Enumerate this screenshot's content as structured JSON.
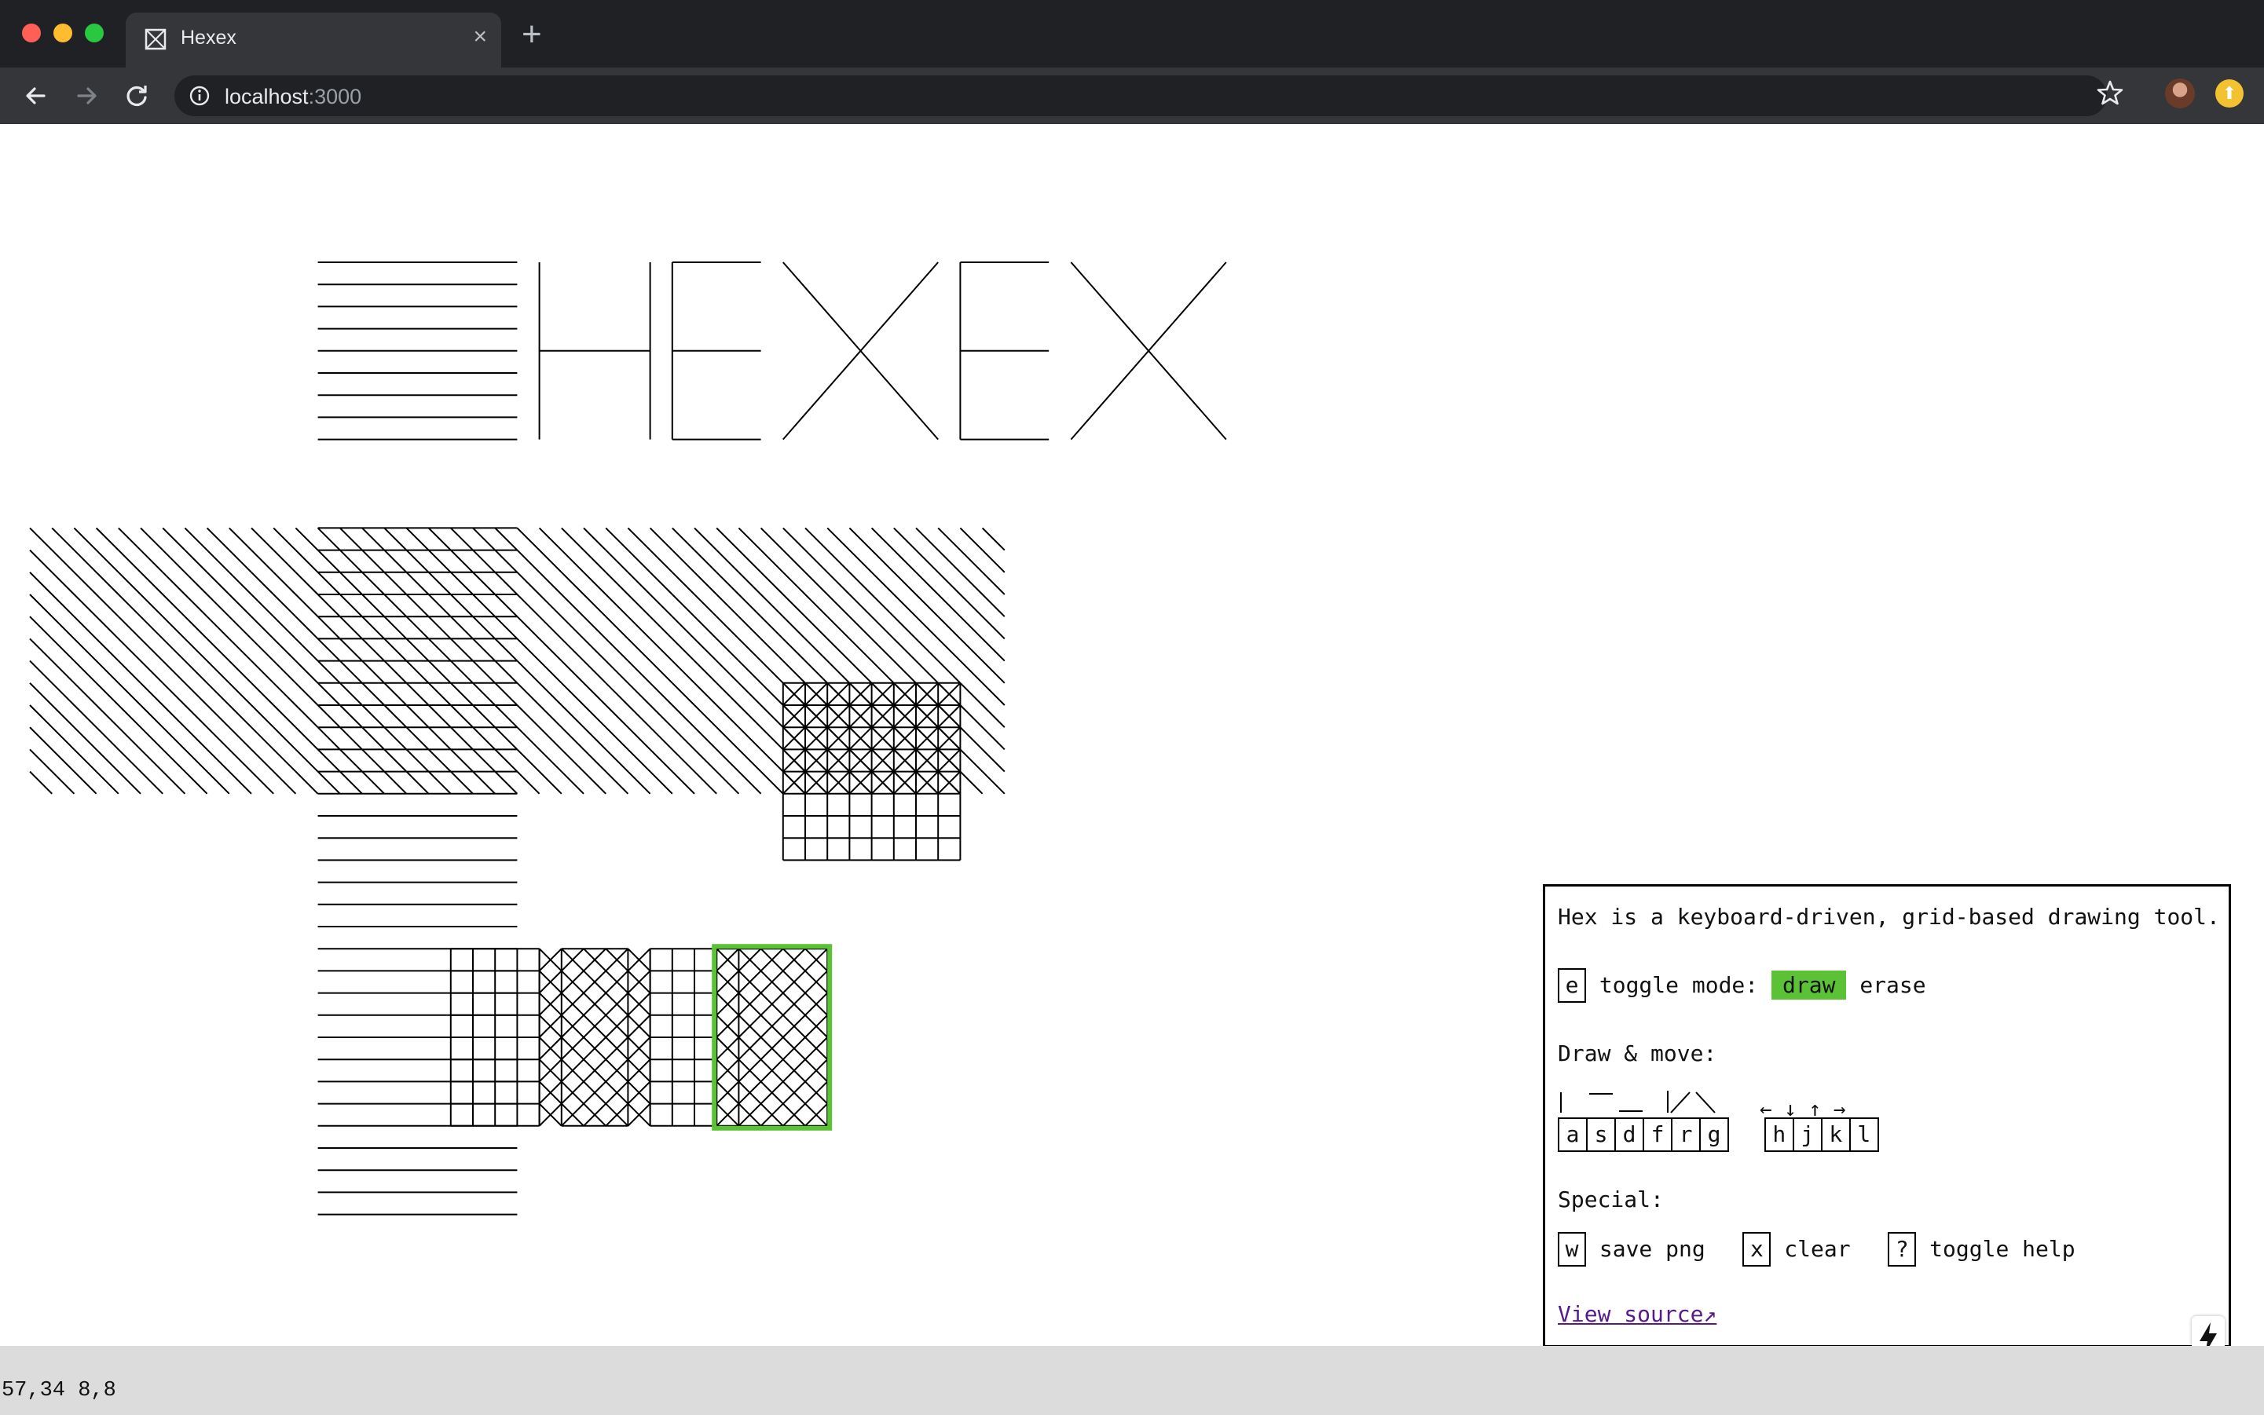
{
  "browser": {
    "tab_title": "Hexex",
    "tab_close": "×",
    "new_tab": "+",
    "url_host": "localhost",
    "url_port": ":3000"
  },
  "status": {
    "text": "57,34 8,8"
  },
  "help": {
    "intro": "Hex is a keyboard-driven, grid-based drawing tool.",
    "mode_key": "e",
    "mode_label": "toggle mode:",
    "mode_draw": "draw",
    "mode_erase": "erase",
    "draw_move_heading": "Draw & move:",
    "draw_keys": [
      "a",
      "s",
      "d",
      "f",
      "r",
      "g"
    ],
    "move_arrows": [
      "←",
      "↓",
      "↑",
      "→"
    ],
    "move_keys": [
      "h",
      "j",
      "k",
      "l"
    ],
    "special_heading": "Special:",
    "special": [
      {
        "key": "w",
        "label": "save png"
      },
      {
        "key": "x",
        "label": "clear"
      },
      {
        "key": "?",
        "label": "toggle help"
      }
    ],
    "view_source": "View source↗"
  },
  "colors": {
    "cursor": "#5bc236",
    "ink": "#000000",
    "chrome_dark": "#202124",
    "chrome_tab": "#35363a"
  }
}
